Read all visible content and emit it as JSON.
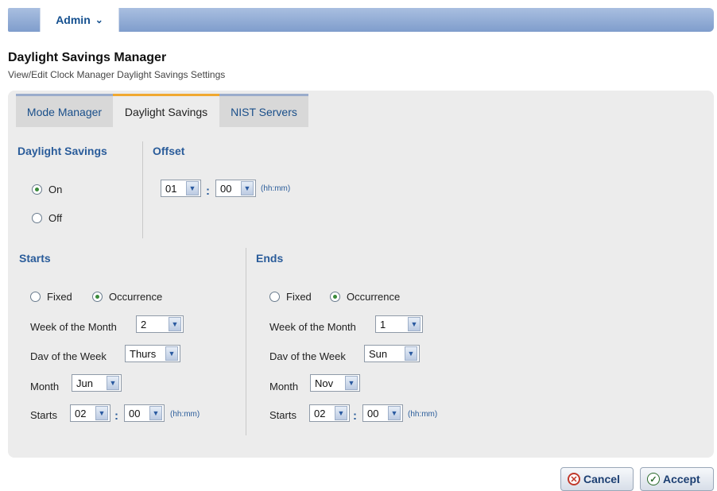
{
  "nav": {
    "admin_label": "Admin",
    "chevron_glyph": "⌄"
  },
  "header": {
    "title": "Daylight Savings Manager",
    "subtitle": "View/Edit Clock Manager Daylight Savings Settings"
  },
  "tabs": [
    {
      "label": "Mode Manager",
      "active": false
    },
    {
      "label": "Daylight Savings",
      "active": true
    },
    {
      "label": "NIST Servers",
      "active": false
    }
  ],
  "daylight": {
    "title": "Daylight Savings",
    "on_label": "On",
    "off_label": "Off",
    "selected": "On"
  },
  "offset": {
    "title": "Offset",
    "hours": "01",
    "minutes": "00",
    "format_hint": "(hh:mm)"
  },
  "starts": {
    "title": "Starts",
    "fixed_label": "Fixed",
    "occurrence_label": "Occurrence",
    "mode": "Occurrence",
    "week_label": "Week of the Month",
    "week_value": "2",
    "day_label": "Dav of the Week",
    "day_value": "Thurs",
    "month_label": "Month",
    "month_value": "Jun",
    "time_label": "Starts",
    "hours": "02",
    "minutes": "00",
    "format_hint": "(hh:mm)"
  },
  "ends": {
    "title": "Ends",
    "fixed_label": "Fixed",
    "occurrence_label": "Occurrence",
    "mode": "Occurrence",
    "week_label": "Week of the Month",
    "week_value": "1",
    "day_label": "Dav of the Week",
    "day_value": "Sun",
    "month_label": "Month",
    "month_value": "Nov",
    "time_label": "Starts",
    "hours": "02",
    "minutes": "00",
    "format_hint": "(hh:mm)"
  },
  "colon": ":",
  "dropdown_glyph": "▼",
  "buttons": {
    "cancel_label": "Cancel",
    "accept_label": "Accept",
    "cancel_glyph": "✕",
    "accept_glyph": "✓"
  },
  "colors": {
    "accent": "#2a5c9a",
    "active_tab": "#f0a830",
    "nav": "#7f9dcc"
  },
  "icons": [
    "chevron-down-icon",
    "dropdown-arrow-icon",
    "cancel-icon",
    "check-icon"
  ]
}
